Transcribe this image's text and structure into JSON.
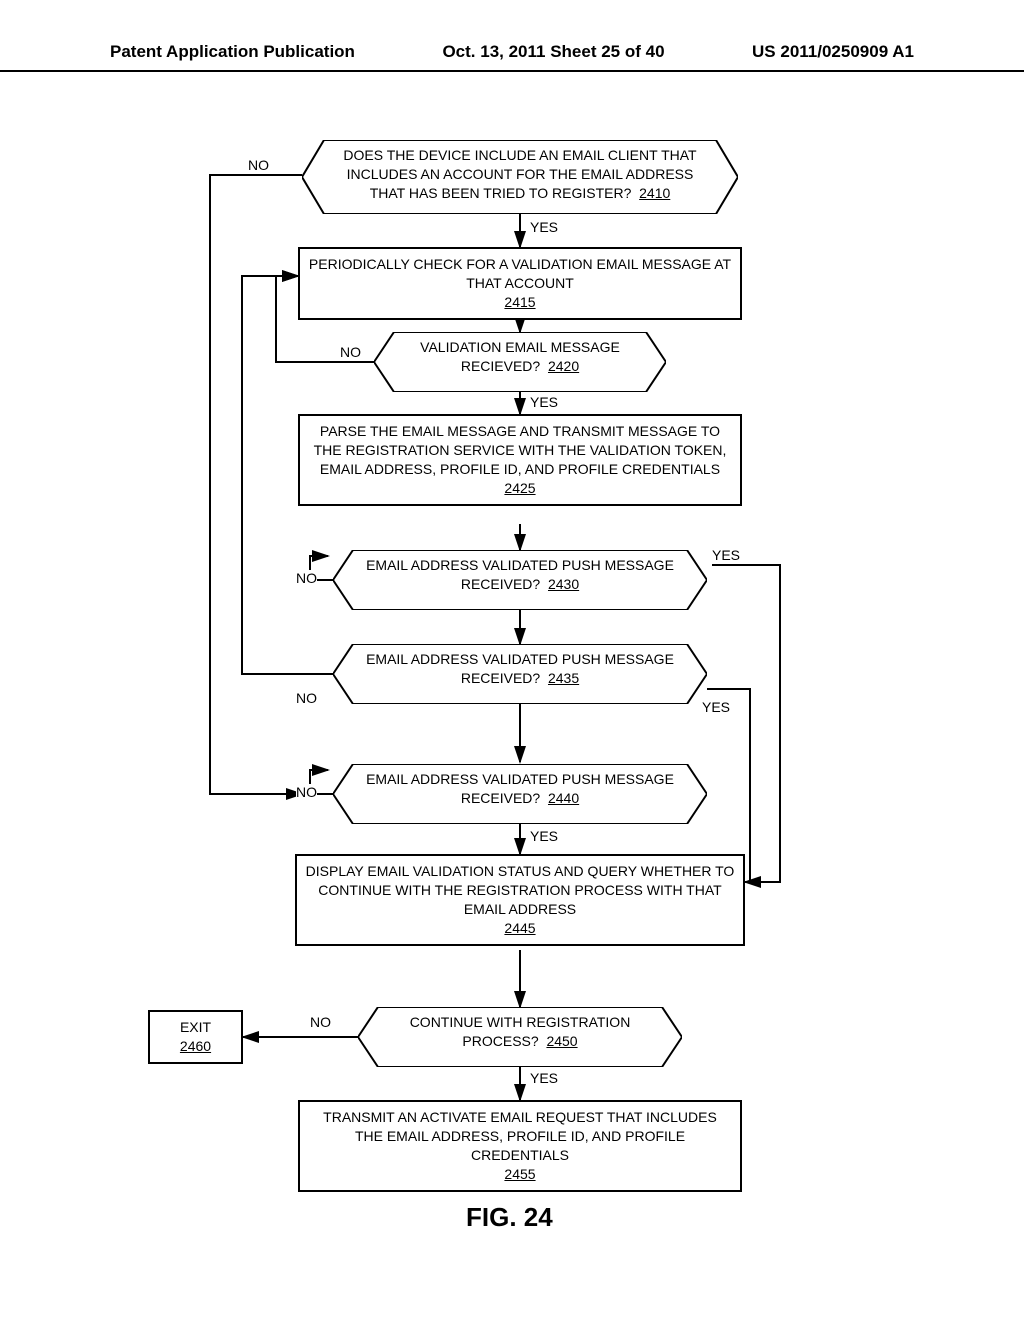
{
  "header": {
    "left": "Patent Application Publication",
    "middle": "Oct. 13, 2011   Sheet 25 of 40",
    "right": "US 2011/0250909 A1"
  },
  "nodes": {
    "n2410": {
      "text": "DOES THE DEVICE INCLUDE AN EMAIL CLIENT THAT INCLUDES AN ACCOUNT FOR THE EMAIL ADDRESS THAT HAS BEEN TRIED TO REGISTER?",
      "ref": "2410"
    },
    "n2415": {
      "text": "PERIODICALLY CHECK FOR A VALIDATION EMAIL MESSAGE AT THAT ACCOUNT",
      "ref": "2415"
    },
    "n2420": {
      "text": "VALIDATION EMAIL MESSAGE RECIEVED?",
      "ref": "2420"
    },
    "n2425": {
      "text": "PARSE THE EMAIL MESSAGE AND TRANSMIT MESSAGE TO THE REGISTRATION SERVICE WITH THE VALIDATION TOKEN, EMAIL ADDRESS, PROFILE ID, AND PROFILE CREDENTIALS",
      "ref": "2425"
    },
    "n2430": {
      "text": "EMAIL ADDRESS VALIDATED PUSH MESSAGE RECEIVED?",
      "ref": "2430"
    },
    "n2435": {
      "text": "EMAIL ADDRESS VALIDATED PUSH MESSAGE RECEIVED?",
      "ref": "2435"
    },
    "n2440": {
      "text": "EMAIL ADDRESS VALIDATED PUSH MESSAGE RECEIVED?",
      "ref": "2440"
    },
    "n2445": {
      "text": "DISPLAY EMAIL VALIDATION STATUS AND QUERY WHETHER TO CONTINUE WITH THE REGISTRATION PROCESS WITH THAT EMAIL ADDRESS",
      "ref": "2445"
    },
    "n2450": {
      "text": "CONTINUE WITH REGISTRATION PROCESS?",
      "ref": "2450"
    },
    "n2455": {
      "text": "TRANSMIT AN ACTIVATE EMAIL REQUEST THAT INCLUDES THE EMAIL ADDRESS, PROFILE ID, AND PROFILE CREDENTIALS",
      "ref": "2455"
    },
    "n2460": {
      "text": "EXIT",
      "ref": "2460"
    }
  },
  "labels": {
    "yes": "YES",
    "no": "NO"
  },
  "figure": "FIG. 24"
}
